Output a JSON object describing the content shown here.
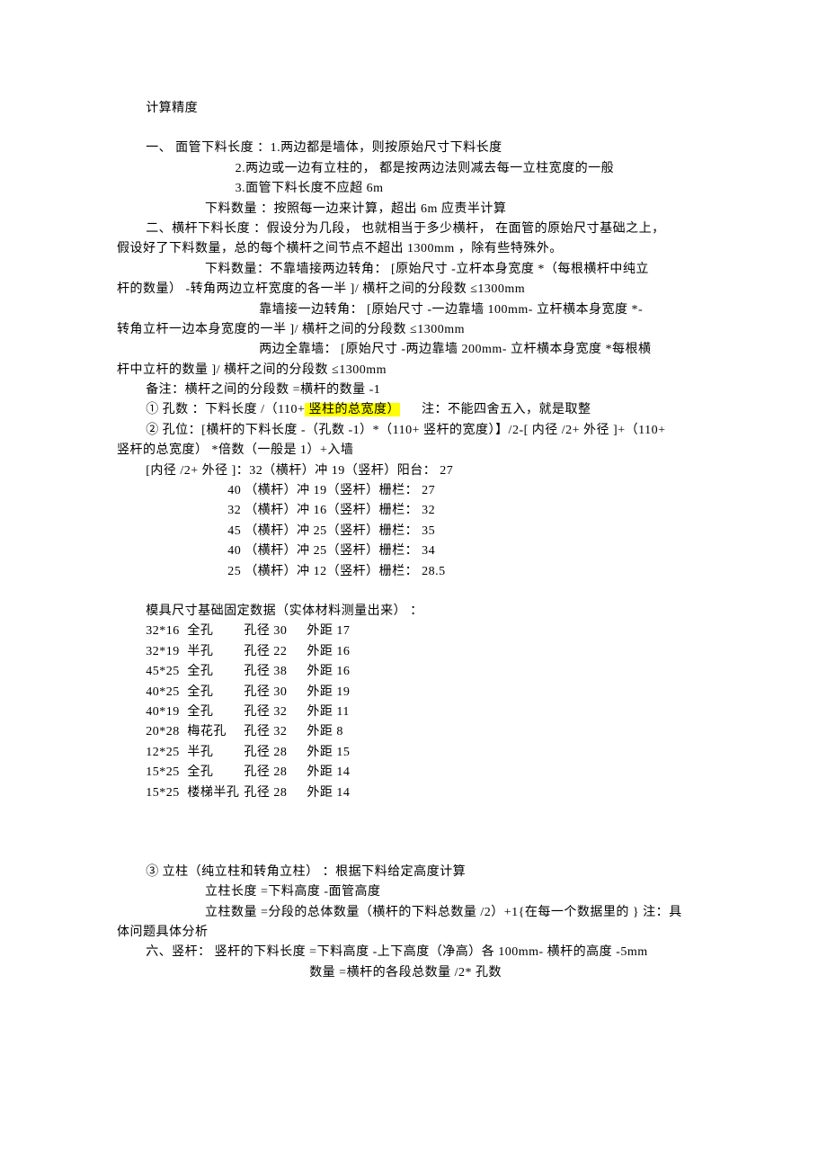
{
  "title": "计算精度",
  "sec1": {
    "l1": "一、 面管下料长度   ：1.两边都是墙体，则按原始尺寸下料长度",
    "l2": "2.两边或一边有立柱的，   都是按两边法则减去每一立柱宽度的一般",
    "l3": "3.面管下料长度不应超    6m",
    "l4": "下料数量 ：按照每一边来计算，超出    6m 应责半计算"
  },
  "sec2": {
    "l1": "二、横杆下料长度 ：假设分为几段， 也就相当于多少横杆， 在面管的原始尺寸基础之上，",
    "l2": "假设好了下料数量，总的每个横杆之间节点不超出      1300mm ，除有些特殊外。",
    "l3": "下料数量：不靠墙接两边转角：     [原始尺寸 -立杆本身宽度  *（每根横杆中纯立",
    "l4": "杆的数量）  -转角两边立杆宽度的各一半   ]/ 横杆之间的分段数  ≤1300mm",
    "l5": "靠墙接一边转角：   [原始尺寸 -一边靠墙   100mm- 立杆横本身宽度  *-",
    "l6": "转角立杆一边本身宽度的一半    ]/ 横杆之间的分段数  ≤1300mm",
    "l7": "两边全靠墙：  [原始尺寸 -两边靠墙 200mm- 立杆横本身宽度  *每根横",
    "l8": "杆中立杆的数量  ]/ 横杆之间的分段数  ≤1300mm",
    "l9": "备注：横杆之间的分段数    =横杆的数量 -1"
  },
  "sec3": {
    "l1_a": "①  孔数 ：下料长度 /（110+",
    "l1_hl": " 竖柱的总宽度）",
    "l1_b": "      注：不能四舍五入，就是取整",
    "l2": "②  孔位：[横杆的下料长度  -（孔数 -1）*（110+ 竖杆的宽度）】/2-[ 内径 /2+ 外径 ]+（110+",
    "l3": "竖杆的总宽度）  *倍数（一般是  1）+入墙",
    "l4": "[内径 /2+ 外径 ]：32（横杆）冲  19（竖杆）阳台：  27"
  },
  "punch": [
    "40 （横杆）冲  19（竖杆）栅栏：   27",
    "32 （横杆）冲  16（竖杆）栅栏：   32",
    "45 （横杆）冲  25（竖杆）栅栏：   35",
    "40 （横杆）冲  25（竖杆）栅栏：   34",
    "25 （横杆）冲  12（竖杆）栅栏：   28.5"
  ],
  "mold_title": "模具尺寸基础固定数据（实体材料测量出来）    ：",
  "mold": [
    {
      "c1": "32*16",
      "c2": "全孔",
      "c3": "孔径 30",
      "c4": "外距 17"
    },
    {
      "c1": "32*19",
      "c2": "半孔",
      "c3": "孔径 22",
      "c4": "外距 16"
    },
    {
      "c1": "45*25",
      "c2": "全孔",
      "c3": "孔径 38",
      "c4": "外距 16"
    },
    {
      "c1": "40*25",
      "c2": "全孔",
      "c3": "孔径 30",
      "c4": "外距 19"
    },
    {
      "c1": "40*19",
      "c2": "全孔",
      "c3": "孔径 32",
      "c4": "外距 11"
    },
    {
      "c1": "20*28",
      "c2": "梅花孔",
      "c3": "孔径 32",
      "c4": "外距 8"
    },
    {
      "c1": "12*25",
      "c2": "半孔",
      "c3": "孔径 28",
      "c4": "外距 15"
    },
    {
      "c1": "15*25",
      "c2": "全孔",
      "c3": "孔径 28",
      "c4": "外距 14"
    },
    {
      "c1": "15*25",
      "c2": "楼梯半孔",
      "c3": "孔径 28",
      "c4": "外距 14"
    }
  ],
  "sec5": {
    "l1": "③   立柱（纯立柱和转角立柱）   ：根据下料给定高度计算",
    "l2": "立柱长度 =下料高度 -面管高度",
    "l3": "立柱数量 =分段的总体数量（横杆的下料总数量    /2）+1{在每一个数据里的  } 注：具",
    "l4": "体问题具体分析"
  },
  "sec6": {
    "l1": "六、竖杆：   竖杆的下料长度  =下料高度 -上下高度（净高）各  100mm- 横杆的高度 -5mm",
    "l2": "数量 =横杆的各段总数量   /2* 孔数"
  }
}
